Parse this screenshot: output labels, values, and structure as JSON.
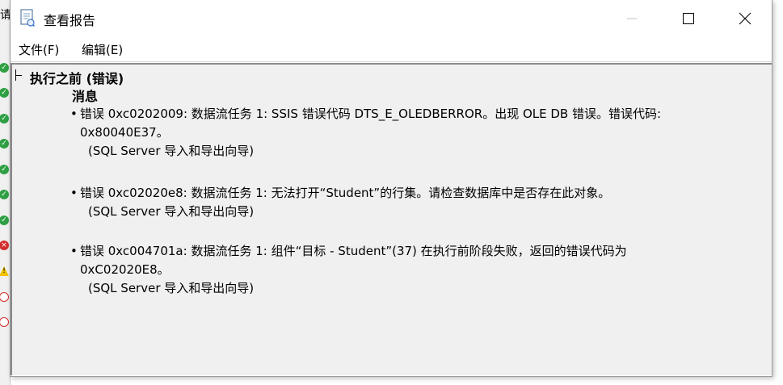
{
  "background_window": {
    "title_fragment": "请"
  },
  "window": {
    "title": "查看报告"
  },
  "menu": {
    "file": "文件(F)",
    "edit": "编辑(E)"
  },
  "report": {
    "section_title": "执行之前 (错误)",
    "messages_label": "消息",
    "messages": [
      {
        "bullet": "•",
        "line1": "错误 0xc0202009: 数据流任务 1: SSIS 错误代码 DTS_E_OLEDBERROR。出现 OLE DB 错误。错误代码:",
        "line2": "0x80040E37。",
        "source": "(SQL Server 导入和导出向导)"
      },
      {
        "bullet": "•",
        "line1": "错误 0xc02020e8: 数据流任务 1: 无法打开“Student”的行集。请检查数据库中是否存在此对象。",
        "line2": "",
        "source": "(SQL Server 导入和导出向导)"
      },
      {
        "bullet": "•",
        "line1": "错误 0xc004701a: 数据流任务 1: 组件“目标 - Student”(37) 在执行前阶段失败，返回的错误代码为",
        "line2": "0xC02020E8。",
        "source": "(SQL Server 导入和导出向导)"
      }
    ]
  },
  "status_icons": [
    "check-icon",
    "check-icon",
    "check-icon",
    "check-icon",
    "check-icon",
    "check-icon",
    "check-icon",
    "error-icon",
    "warning-icon",
    "stop-icon",
    "stop-icon"
  ],
  "colors": {
    "success": "#2ea043",
    "error": "#d32f2f",
    "warning": "#f2c200",
    "content_background": "#f0f0f0"
  }
}
